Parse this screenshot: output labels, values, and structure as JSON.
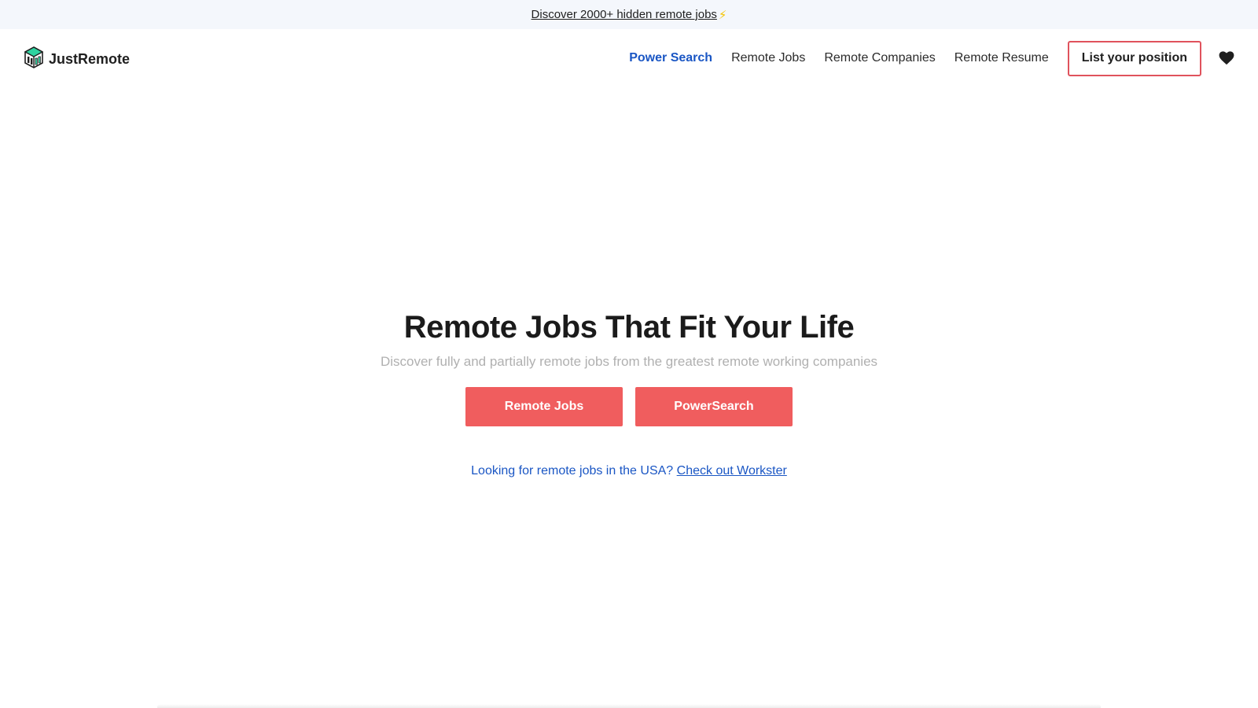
{
  "announcement": {
    "link_text": "Discover 2000+ hidden remote jobs",
    "emoji": "⚡"
  },
  "brand": {
    "name": "JustRemote",
    "logo_icon": "building-logo-icon"
  },
  "nav": {
    "items": [
      {
        "label": "Power Search",
        "active": true
      },
      {
        "label": "Remote Jobs",
        "active": false
      },
      {
        "label": "Remote Companies",
        "active": false
      },
      {
        "label": "Remote Resume",
        "active": false
      }
    ],
    "cta_label": "List your position",
    "favorites_icon": "heart-icon"
  },
  "hero": {
    "title": "Remote Jobs That Fit Your Life",
    "subtitle": "Discover fully and partially remote jobs from the greatest remote working companies",
    "buttons": [
      "Remote Jobs",
      "PowerSearch"
    ],
    "usa_prompt": "Looking for remote jobs in the USA?",
    "usa_link": "Check out Workster"
  },
  "colors": {
    "accent_red": "#f05d5e",
    "link_blue": "#1a56c4",
    "banner_bg": "#f4f7fc",
    "logo_green": "#2fd3a0"
  }
}
